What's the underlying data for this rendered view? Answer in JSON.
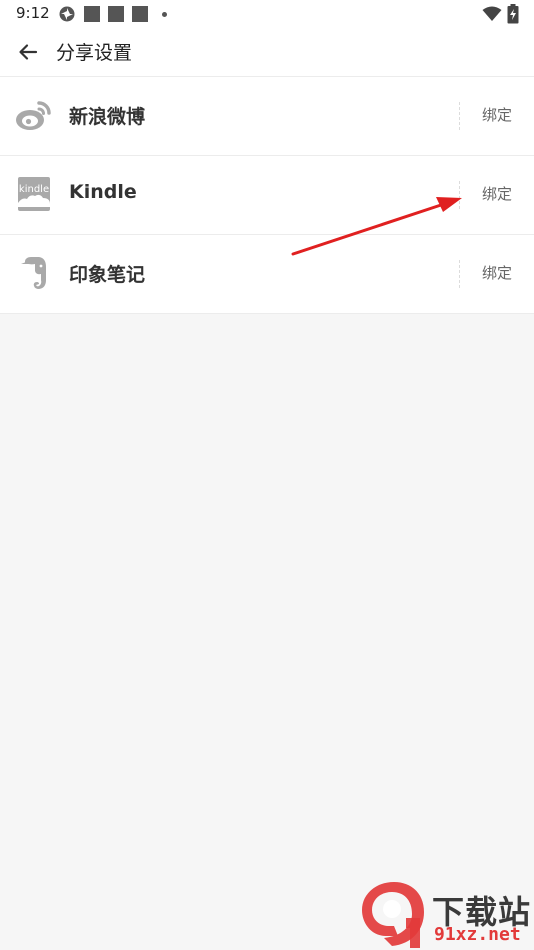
{
  "status_bar": {
    "time": "9:12"
  },
  "header": {
    "title": "分享设置"
  },
  "share_items": [
    {
      "label": "新浪微博",
      "icon": "weibo-icon",
      "action": "绑定"
    },
    {
      "label": "Kindle",
      "icon": "kindle-icon",
      "icon_text": "kindle",
      "action": "绑定"
    },
    {
      "label": "印象笔记",
      "icon": "evernote-icon",
      "action": "绑定"
    }
  ],
  "annotation": {
    "type": "red-arrow",
    "color": "#e02020",
    "target": "share_items.1.action"
  },
  "watermark": {
    "logo_text": "9",
    "text_cn": "下载站",
    "text_en": "91xz.net",
    "colors": {
      "red": "#e23a3a",
      "dark": "#3a3a3a"
    }
  },
  "colors": {
    "background": "#f6f6f6",
    "surface": "#ffffff",
    "divider": "#ececec",
    "icon_gray": "#a9a9a9"
  }
}
